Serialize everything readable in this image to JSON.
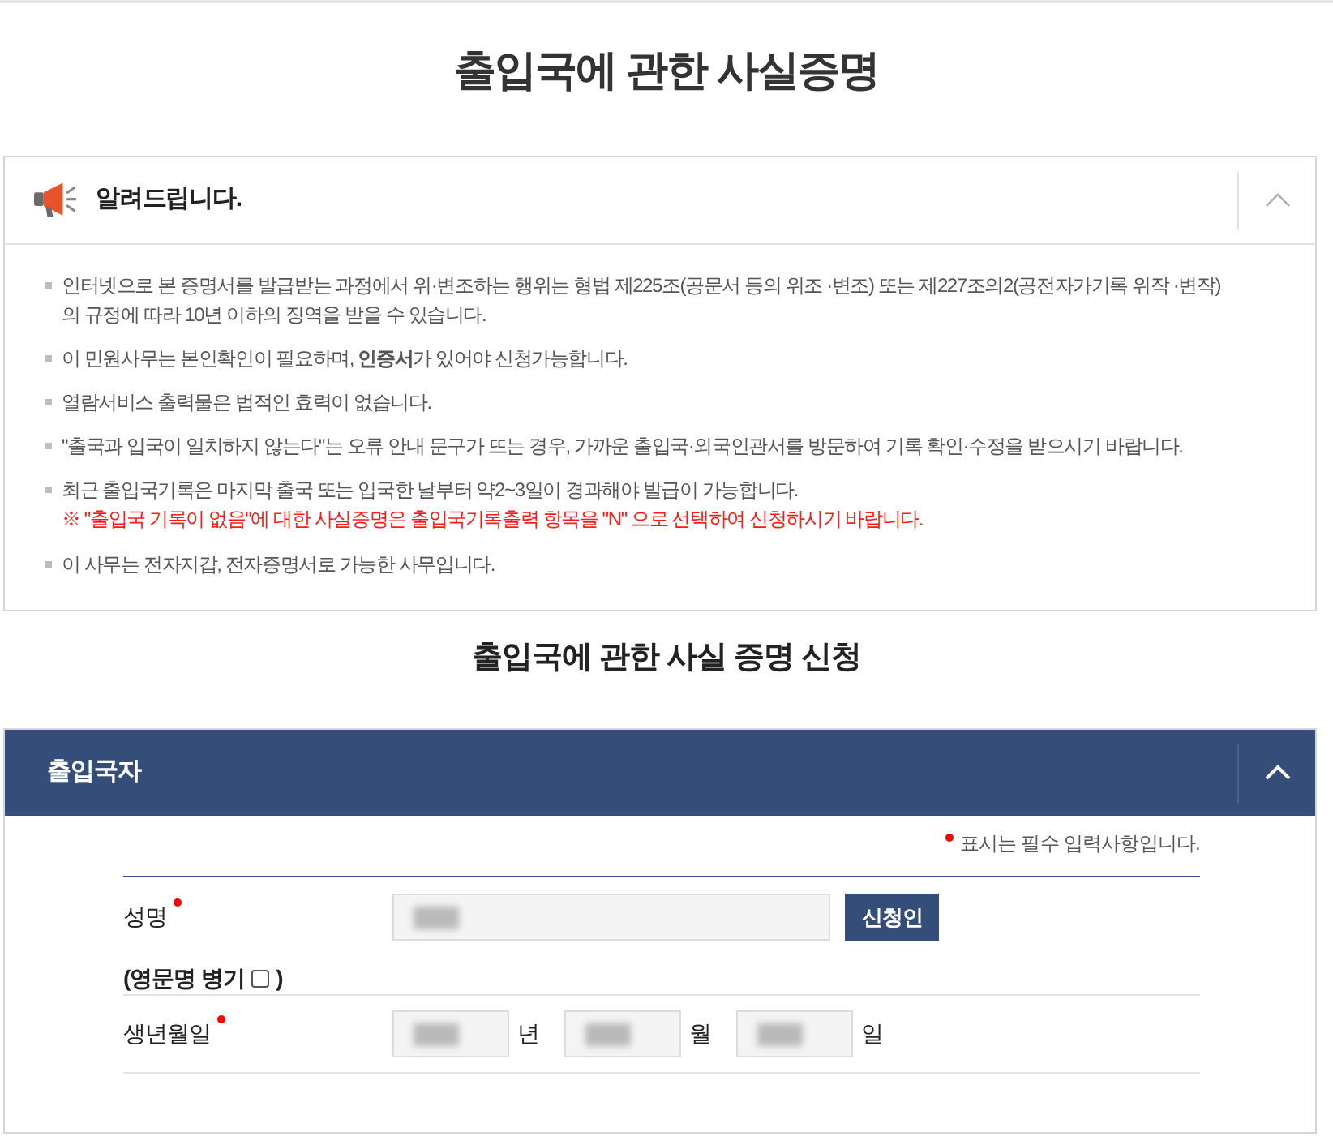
{
  "page_title": "출입국에 관한 사실증명",
  "notice": {
    "title": "알려드립니다.",
    "expanded": true,
    "items": [
      {
        "text": "인터넷으로 본 증명서를 발급받는 과정에서 위·변조하는 행위는 형법 제225조(공문서 등의 위조 ·변조) 또는 제227조의2(공전자가기록 위작 ·변작) 의 규정에 따라 10년 이하의 징역을 받을 수 있습니다."
      },
      {
        "text": "이 민원사무는 본인확인이 필요하며, **인증서**가 있어야 신청가능합니다."
      },
      {
        "text": "열람서비스 출력물은 법적인 효력이 없습니다."
      },
      {
        "text": "\"출국과 입국이 일치하지 않는다\"는 오류 안내 문구가 뜨는 경우, 가까운 출입국·외국인관서를 방문하여 기록 확인·수정을 받으시기 바랍니다."
      },
      {
        "text": "최근 출입국기록은 마지막 출국 또는 입국한 날부터 약2~3일이 경과해야 발급이 가능합니다.",
        "note": "※ \"출입국 기록이 없음\"에 대한 사실증명은 출입국기록출력 항목을 \"N\" 으로 선택하여 신청하시기 바랍니다."
      },
      {
        "text": "이 사무는 전자지갑, 전자증명서로 가능한 사무입니다."
      }
    ]
  },
  "form_title": "출입국에 관한 사실 증명 신청",
  "applicant_section": {
    "title": "출입국자",
    "expanded": true,
    "required_note": "표시는 필수 입력사항입니다.",
    "name_row": {
      "label": "성명",
      "required": true,
      "button": "신청인"
    },
    "english_name": {
      "label": "(영문명 병기",
      "checked": false,
      "closing": ")"
    },
    "birth_row": {
      "label": "생년월일",
      "required": true,
      "parts": [
        {
          "unit": "년"
        },
        {
          "unit": "월"
        },
        {
          "unit": "일"
        }
      ]
    }
  }
}
